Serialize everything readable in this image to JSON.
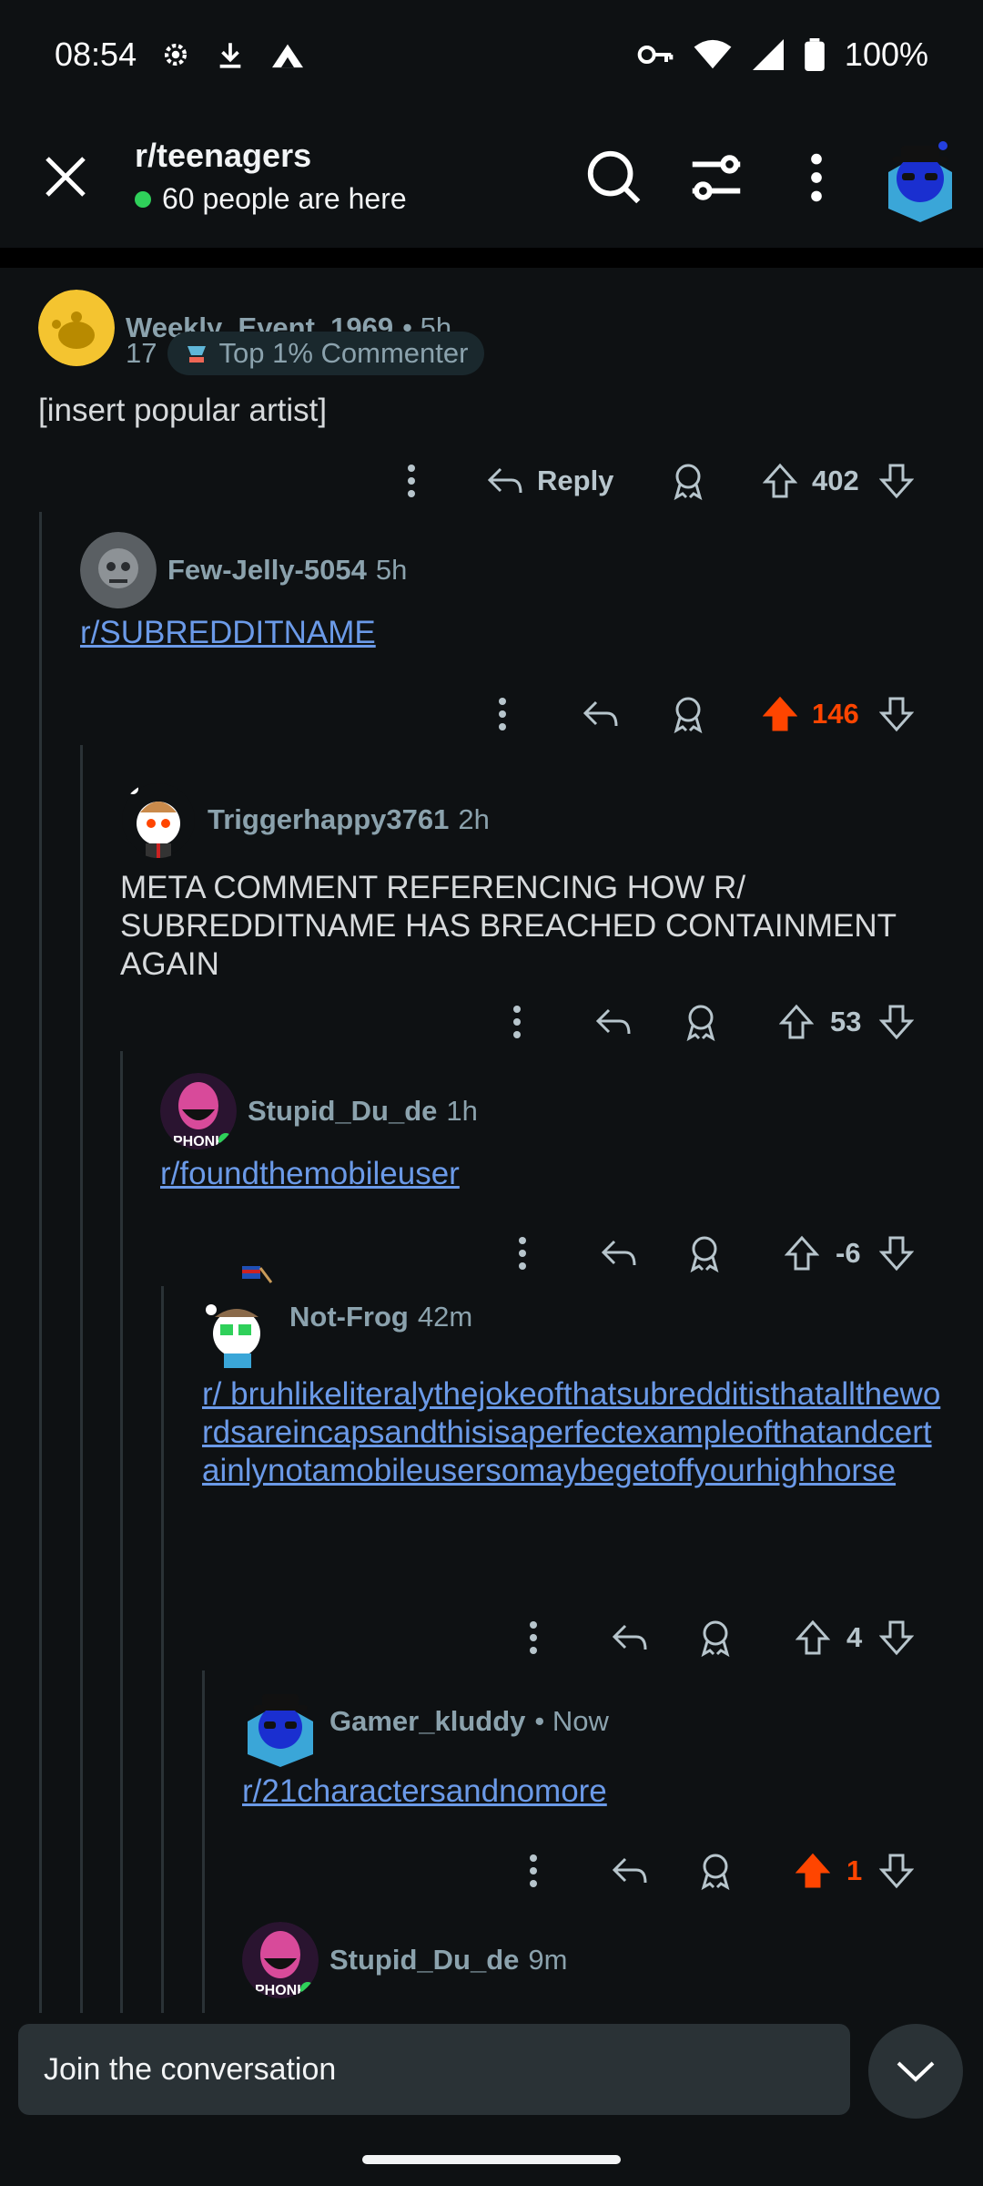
{
  "status_bar": {
    "time": "08:54",
    "battery": "100%",
    "icons": [
      "settings-icon",
      "download-icon",
      "app-icon",
      "vpn-key-icon",
      "wifi-icon",
      "signal-icon",
      "battery-icon"
    ]
  },
  "header": {
    "subreddit": "r/teenagers",
    "online_text": "60 people are here",
    "icons": [
      "close-icon",
      "search-icon",
      "filter-icon",
      "more-icon",
      "user-avatar"
    ]
  },
  "comments": [
    {
      "user": "Weekly_Event_1969",
      "meta": "• 5h",
      "flair_num": "17",
      "flair": "Top 1% Commenter",
      "body": "[insert popular artist]",
      "reply_label": "Reply",
      "votes": "402",
      "upvoted": false
    },
    {
      "user": "Few-Jelly-5054",
      "meta": "5h",
      "link": "r/SUBREDDITNAME",
      "votes": "146",
      "upvoted": true
    },
    {
      "user": "Triggerhappy3761",
      "meta": "2h",
      "body": "META COMMENT REFERENCING HOW R/ SUBREDDITNAME HAS BREACHED CONTAINMENT AGAIN",
      "votes": "53",
      "upvoted": false
    },
    {
      "user": "Stupid_Du_de",
      "meta": "1h",
      "link": "r/foundthemobileuser",
      "votes": "-6",
      "upvoted": false
    },
    {
      "user": "Not-Frog",
      "meta": "42m",
      "link": "r/ bruhlikeliteralythejokeofthatsubredditisthatallthewordsareincapsandthisisaperfectexampleofthatandcertainlynotamobileusersomaybegetoffyourhighhorse",
      "votes": "4",
      "upvoted": false
    },
    {
      "user": "Gamer_kluddy",
      "meta": "• Now",
      "link": "r/21charactersandnomore",
      "votes": "1",
      "upvoted": true
    },
    {
      "user": "Stupid_Du_de",
      "meta": "9m"
    }
  ],
  "composer": {
    "placeholder": "Join the conversation"
  },
  "colors": {
    "background": "#0e1113",
    "link": "#6b9ae8",
    "upvote": "#ff4500",
    "meta": "#8ba2ad",
    "thread_line": "#2a3236"
  }
}
